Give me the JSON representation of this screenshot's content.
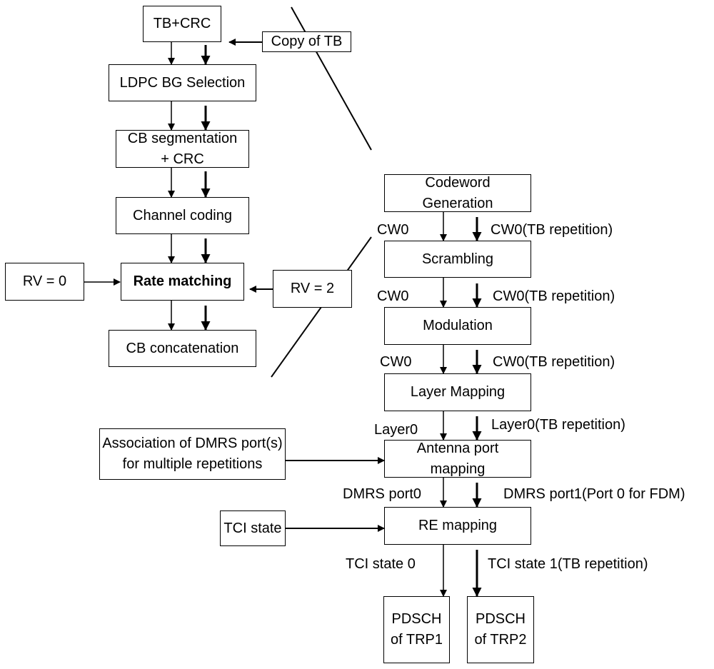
{
  "left_chain": {
    "tb_crc": "TB+CRC",
    "ldpc": "LDPC BG Selection",
    "cb_seg_line1": "CB segmentation",
    "cb_seg_line2": "+ CRC",
    "channel_coding": "Channel coding",
    "rate_matching": "Rate matching",
    "cb_concat": "CB concatenation"
  },
  "inputs": {
    "copy_of_tb": "Copy of TB",
    "rv0": "RV = 0",
    "rv2": "RV = 2",
    "dmrs_assoc_line1": "Association of DMRS port(s)",
    "dmrs_assoc_line2": "for multiple repetitions",
    "tci_state": "TCI state"
  },
  "right_chain": {
    "codeword_line1": "Codeword",
    "codeword_line2": "Generation",
    "scrambling": "Scrambling",
    "modulation": "Modulation",
    "layer_mapping": "Layer Mapping",
    "antenna_line1": "Antenna port",
    "antenna_line2": "mapping",
    "re_mapping": "RE mapping",
    "pdsch1_line1": "PDSCH",
    "pdsch1_line2": "of TRP1",
    "pdsch2_line1": "PDSCH",
    "pdsch2_line2": "of TRP2"
  },
  "edge_labels": {
    "cw0_a": "CW0",
    "cw0_rep_a": "CW0(TB repetition)",
    "cw0_b": "CW0",
    "cw0_rep_b": "CW0(TB repetition)",
    "cw0_c": "CW0",
    "cw0_rep_c": "CW0(TB repetition)",
    "layer0": "Layer0",
    "layer0_rep": "Layer0(TB repetition)",
    "dmrs_port0": "DMRS port0",
    "dmrs_port1": "DMRS port1(Port 0 for FDM)",
    "tci0": "TCI state 0",
    "tci1": "TCI state 1(TB repetition)"
  }
}
